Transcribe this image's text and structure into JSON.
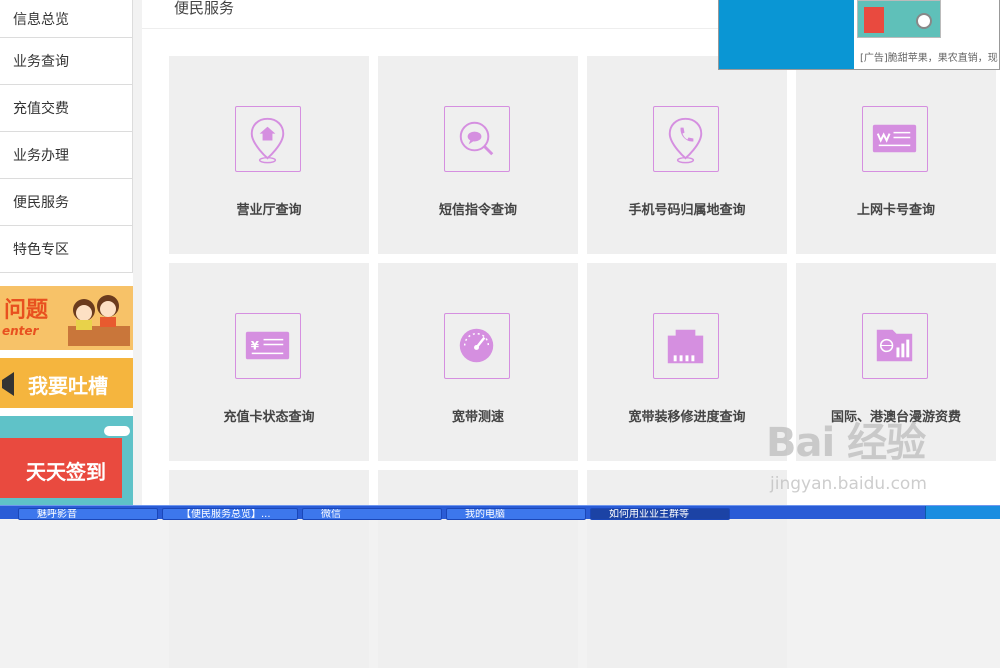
{
  "sidebar": {
    "items": [
      {
        "label": "信息总览"
      },
      {
        "label": "业务查询"
      },
      {
        "label": "充值交费"
      },
      {
        "label": "业务办理"
      },
      {
        "label": "便民服务"
      },
      {
        "label": "特色专区"
      }
    ],
    "banners": {
      "faq": {
        "title": "问题",
        "subtitle": "enter"
      },
      "feedback": {
        "title": "我要吐槽"
      },
      "signin": {
        "title": "天天签到"
      }
    }
  },
  "main": {
    "title": "便民服务",
    "tiles": [
      {
        "label": "营业厅查询",
        "icon": "location-home-icon"
      },
      {
        "label": "短信指令查询",
        "icon": "sms-search-icon"
      },
      {
        "label": "手机号码归属地查询",
        "icon": "phone-location-icon"
      },
      {
        "label": "上网卡号查询",
        "icon": "wifi-card-icon"
      },
      {
        "label": "充值卡状态查询",
        "icon": "recharge-card-icon"
      },
      {
        "label": "宽带测速",
        "icon": "speedometer-icon"
      },
      {
        "label": "宽带装移修进度查询",
        "icon": "ethernet-port-icon"
      },
      {
        "label": "国际、港澳台漫游资费",
        "icon": "roaming-chart-icon"
      }
    ],
    "icon_color": "#d58fe0"
  },
  "ad": {
    "text": "[广告]脆甜苹果，果农直销，现"
  },
  "watermark": {
    "main": "Bai 经验",
    "sub": "jingyan.baidu.com"
  },
  "taskbar": {
    "items": [
      {
        "label": "魅呼影音"
      },
      {
        "label": "【便民服务总览】..."
      },
      {
        "label": "微信"
      },
      {
        "label": "我的电脑"
      },
      {
        "label": "如何用业业主群等"
      }
    ]
  }
}
